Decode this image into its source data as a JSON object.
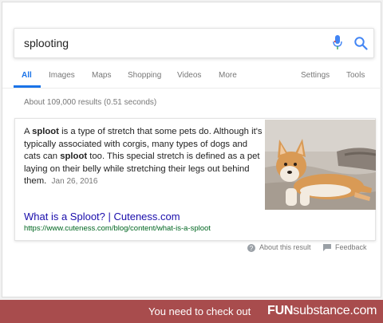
{
  "search": {
    "query": "splooting"
  },
  "tabs": {
    "all": "All",
    "images": "Images",
    "maps": "Maps",
    "shopping": "Shopping",
    "videos": "Videos",
    "more": "More",
    "settings": "Settings",
    "tools": "Tools"
  },
  "results_count": "About 109,000 results (0.51 seconds)",
  "featured": {
    "s1": "A ",
    "b1": "sploot",
    "s2": " is a type of stretch that some pets do. Although it's typically associated with corgis, many types of dogs and cats can ",
    "b2": "sploot",
    "s3": " too. This special stretch is defined as a pet laying on their belly while stretching their legs out behind them.",
    "date": "Jan 26, 2016",
    "title": "What is a Sploot? | Cuteness.com",
    "url": "https://www.cuteness.com/blog/content/what-is-a-sploot"
  },
  "footer": {
    "about": "About this result",
    "feedback": "Feedback"
  },
  "banner": {
    "prefix": "You need to check out",
    "brand_bold": "FUN",
    "brand_rest": "substance.com"
  },
  "colors": {
    "accent_blue": "#1a73e8",
    "link_title": "#1a0dab",
    "url_green": "#006621",
    "banner_bg": "#a84c4d"
  },
  "icons": {
    "mic": "mic-icon",
    "search": "search-icon",
    "help": "help-icon",
    "feedback": "feedback-icon"
  }
}
